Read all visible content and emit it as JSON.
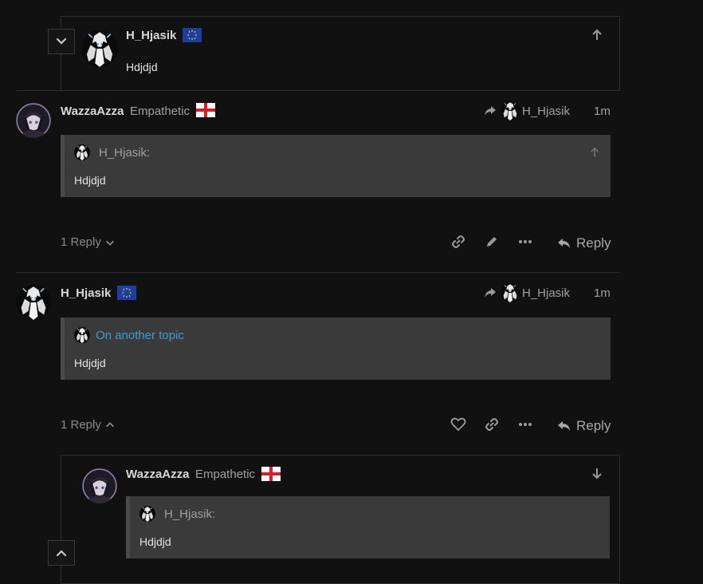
{
  "posts": [
    {
      "username": "H_Hjasik",
      "flag_icon": "eu-flag",
      "body": "Hdjdjd"
    },
    {
      "username": "WazzaAzza",
      "user_title": "Empathetic",
      "flag_icon": "england-flag",
      "reply_to_user": "H_Hjasik",
      "time": "1m",
      "quote": {
        "author": "H_Hjasik:",
        "body": "Hdjdjd"
      },
      "replies_label": "1 Reply",
      "reply_label": "Reply"
    },
    {
      "username": "H_Hjasik",
      "flag_icon": "eu-flag",
      "reply_to_user": "H_Hjasik",
      "time": "1m",
      "quote": {
        "link": "On another topic",
        "body": "Hdjdjd"
      },
      "replies_label": "1 Reply",
      "reply_label": "Reply"
    },
    {
      "username": "WazzaAzza",
      "user_title": "Empathetic",
      "flag_icon": "england-flag",
      "quote": {
        "author": "H_Hjasik:",
        "body": "Hdjdjd"
      }
    }
  ],
  "colors": {
    "background": "#111111",
    "border": "#2e2e2e",
    "quote_bg": "#3a3a3a",
    "link": "#3d9bd8",
    "muted": "#a0a0a0"
  }
}
